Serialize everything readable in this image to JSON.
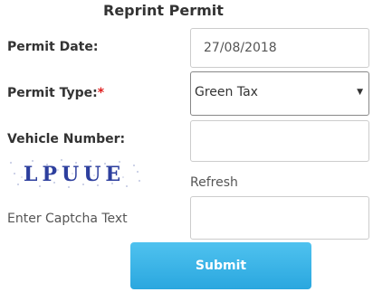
{
  "form": {
    "title": "Reprint Permit",
    "permit_date": {
      "label": "Permit Date:",
      "value": "27/08/2018"
    },
    "permit_type": {
      "label": "Permit Type:",
      "required_mark": "*",
      "selected": "Green Tax",
      "caret": "▼"
    },
    "vehicle_number": {
      "label": "Vehicle Number:",
      "value": ""
    },
    "captcha": {
      "image_text": "LPUUE",
      "refresh_label": "Refresh",
      "input_label": "Enter Captcha Text",
      "value": ""
    },
    "submit_label": "Submit"
  }
}
